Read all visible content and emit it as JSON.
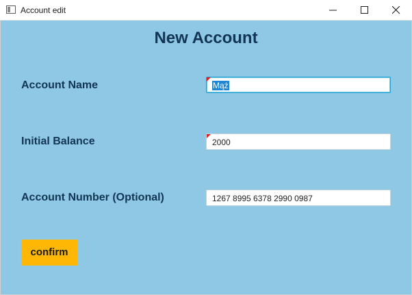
{
  "window": {
    "title": "Account edit"
  },
  "form": {
    "heading": "New Account",
    "fields": [
      {
        "label": "Account Name",
        "value": "Mąż",
        "focused": true,
        "error": true
      },
      {
        "label": "Initial Balance",
        "value": "2000",
        "focused": false,
        "error": true
      },
      {
        "label": "Account Number (Optional)",
        "value": "1267 8995 6378 2990 0987",
        "focused": false,
        "error": false
      }
    ],
    "confirm_label": "confirm"
  },
  "colors": {
    "background": "#8ec8e5",
    "label_text": "#113552",
    "button": "#ffb705",
    "error_mark": "#e02020",
    "focus_border": "#1fa3d3"
  },
  "icons": [
    "window-app-icon",
    "minimize-icon",
    "maximize-icon",
    "close-icon"
  ]
}
